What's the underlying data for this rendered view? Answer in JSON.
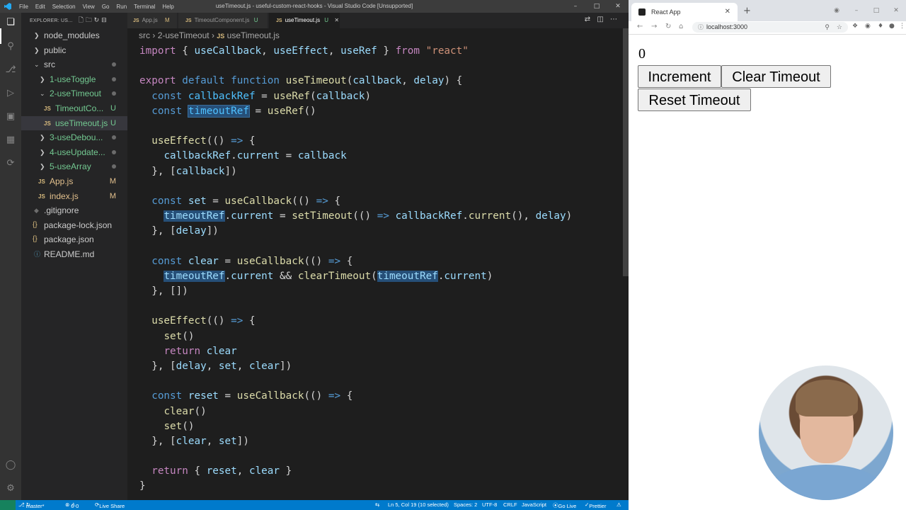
{
  "vscode": {
    "menu": [
      "File",
      "Edit",
      "Selection",
      "View",
      "Go",
      "Run",
      "Terminal",
      "Help"
    ],
    "window_title": "useTimeout.js - useful-custom-react-hooks - Visual Studio Code [Unsupported]",
    "explorer_header": "EXPLORER: US...",
    "tree": [
      {
        "label": "node_modules",
        "indent": 1,
        "type": "folder-closed",
        "status": ""
      },
      {
        "label": "public",
        "indent": 1,
        "type": "folder-closed",
        "status": ""
      },
      {
        "label": "src",
        "indent": 1,
        "type": "folder-open",
        "status": ""
      },
      {
        "label": "1-useToggle",
        "indent": 2,
        "type": "folder-closed",
        "status": ""
      },
      {
        "label": "2-useTimeout",
        "indent": 2,
        "type": "folder-open",
        "status": ""
      },
      {
        "label": "TimeoutCo...",
        "indent": 3,
        "type": "js",
        "status": "U"
      },
      {
        "label": "useTimeout.js",
        "indent": 3,
        "type": "js",
        "status": "U"
      },
      {
        "label": "3-useDebou...",
        "indent": 2,
        "type": "folder-closed",
        "status": ""
      },
      {
        "label": "4-useUpdate...",
        "indent": 2,
        "type": "folder-closed",
        "status": ""
      },
      {
        "label": "5-useArray",
        "indent": 2,
        "type": "folder-closed",
        "status": ""
      },
      {
        "label": "App.js",
        "indent": 2,
        "type": "js",
        "status": "M"
      },
      {
        "label": "index.js",
        "indent": 2,
        "type": "js",
        "status": "M"
      },
      {
        "label": ".gitignore",
        "indent": 1,
        "type": "git",
        "status": ""
      },
      {
        "label": "package-lock.json",
        "indent": 1,
        "type": "json",
        "status": ""
      },
      {
        "label": "package.json",
        "indent": 1,
        "type": "json",
        "status": ""
      },
      {
        "label": "README.md",
        "indent": 1,
        "type": "info",
        "status": ""
      }
    ],
    "tabs": [
      {
        "label": "App.js",
        "status": "M"
      },
      {
        "label": "TimeoutComponent.js",
        "status": "U"
      },
      {
        "label": "useTimeout.js",
        "status": "U"
      }
    ],
    "breadcrumb": {
      "folder1": "src",
      "folder2": "2-useTimeout",
      "file": "useTimeout.js"
    },
    "code_lines": [
      "import { useCallback, useEffect, useRef } from \"react\"",
      "",
      "export default function useTimeout(callback, delay) {",
      "  const callbackRef = useRef(callback)",
      "  const timeoutRef = useRef()",
      "",
      "  useEffect(() => {",
      "    callbackRef.current = callback",
      "  }, [callback])",
      "",
      "  const set = useCallback(() => {",
      "    timeoutRef.current = setTimeout(() => callbackRef.current(), delay)",
      "  }, [delay])",
      "",
      "  const clear = useCallback(() => {",
      "    timeoutRef.current && clearTimeout(timeoutRef.current)",
      "  }, [])",
      "",
      "  useEffect(() => {",
      "    set()",
      "    return clear",
      "  }, [delay, set, clear])",
      "",
      "  const reset = useCallback(() => {",
      "    clear()",
      "    set()",
      "  }, [clear, set])",
      "",
      "  return { reset, clear }",
      "}"
    ],
    "status": {
      "branch": "master*",
      "errors": "0",
      "warnings": "0",
      "live_share": "Live Share",
      "cursor": "Ln 5, Col 19 (10 selected)",
      "spaces": "Spaces: 2",
      "encoding": "UTF-8",
      "eol": "CRLF",
      "language": "JavaScript",
      "go_live": "Go Live",
      "prettier": "Prettier"
    }
  },
  "browser": {
    "tab_title": "React App",
    "url": "localhost:3000",
    "count": "0",
    "buttons": {
      "increment": "Increment",
      "clear": "Clear Timeout",
      "reset": "Reset Timeout"
    }
  }
}
